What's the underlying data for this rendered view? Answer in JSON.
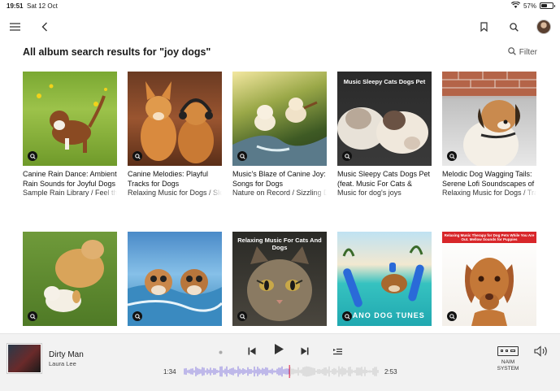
{
  "status_bar": {
    "time": "19:51",
    "date": "Sat 12 Oct",
    "battery": "57%",
    "battery_level": 0.57
  },
  "nav": {
    "icons": [
      "menu-icon",
      "back-icon",
      "bookmark-icon",
      "search-icon",
      "avatar"
    ]
  },
  "header": {
    "title": "All album search results for \"joy dogs\"",
    "filter_label": "Filter"
  },
  "albums": [
    {
      "title": "Canine Rain Dance: Ambient",
      "title2": "Rain Sounds for Joyful Dogs",
      "subtitle": "Sample Rain Library / Feel the",
      "cover_text": ""
    },
    {
      "title": "Canine Melodies: Playful",
      "title2": "Tracks for Dogs",
      "subtitle": "Relaxing Music for Dogs / Sleepy",
      "cover_text": ""
    },
    {
      "title": "Music's Blaze of Canine Joy:",
      "title2": "Songs for Dogs",
      "subtitle": "Nature on Record / Sizzling Dogs",
      "cover_text": ""
    },
    {
      "title": "Music Sleepy Cats Dogs Pet",
      "title2": "(feat. Music For Cats &",
      "subtitle": "Music for dog's joys",
      "cover_text": "Music Sleepy Cats Dogs Pet"
    },
    {
      "title": "Melodic Dog Wagging Tails:",
      "title2": "Serene Lofi Soundscapes of",
      "subtitle": "Relaxing Music for Dogs / Tranquil",
      "cover_text": ""
    },
    {
      "title": "",
      "title2": "",
      "subtitle": "",
      "cover_text": ""
    },
    {
      "title": "",
      "title2": "",
      "subtitle": "",
      "cover_text": ""
    },
    {
      "title": "",
      "title2": "",
      "subtitle": "",
      "cover_text": "Relaxing Music For Cats And Dogs"
    },
    {
      "title": "",
      "title2": "",
      "subtitle": "",
      "cover_text": "PIANO DOG TUNES"
    },
    {
      "title": "",
      "title2": "",
      "subtitle": "",
      "cover_text": "Relaxing Music Therapy for Dog Pets While You Are Out. Mellow Sounds for Puppies"
    }
  ],
  "player": {
    "track": "Dirty Man",
    "artist": "Laura Lee",
    "elapsed": "1:34",
    "duration": "2:53",
    "progress": 0.54,
    "system_label_1": "NAIM",
    "system_label_2": "SYSTEM"
  },
  "colors": {
    "accent": "#8a7ee0",
    "progress_marker": "#e04060"
  }
}
